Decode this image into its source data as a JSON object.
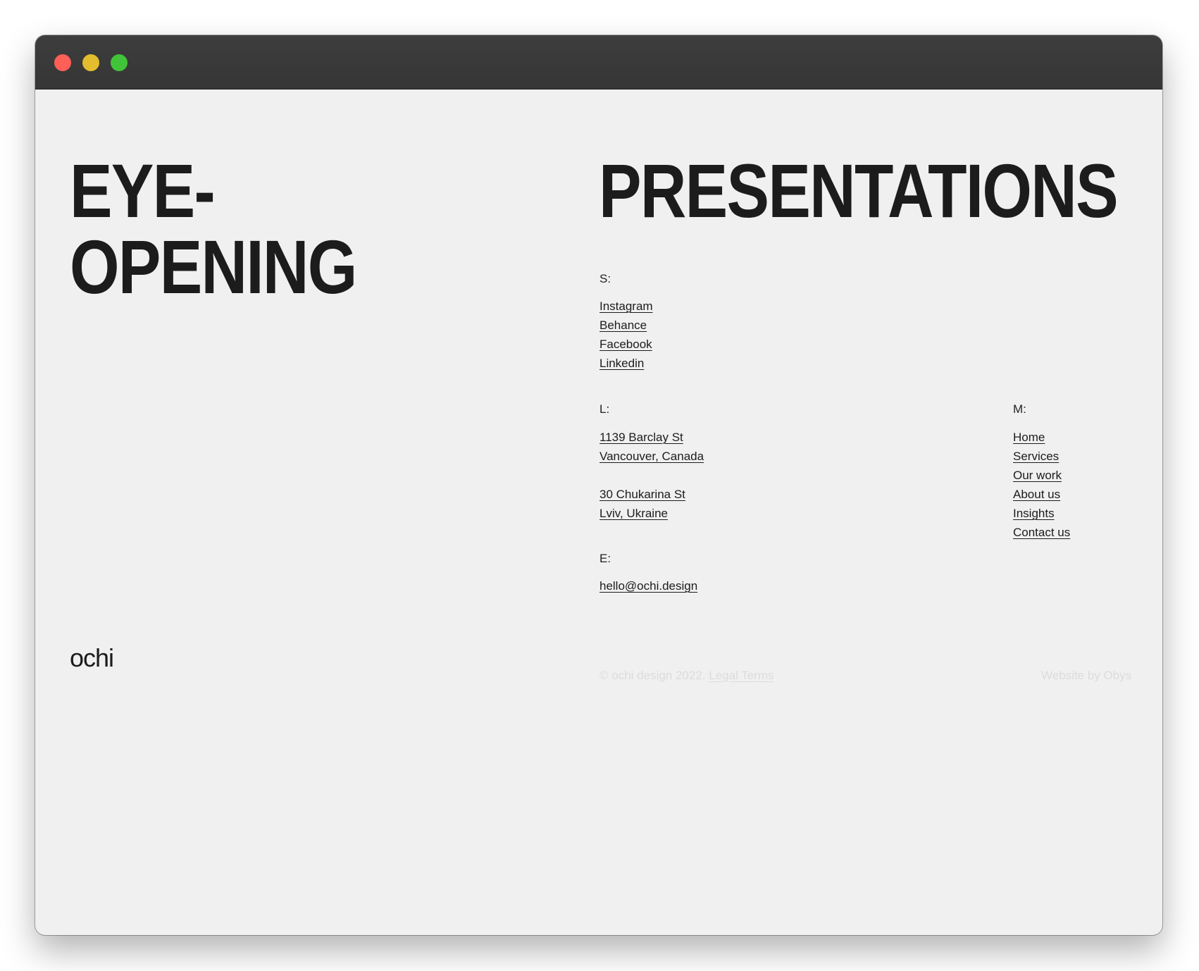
{
  "window": {
    "controls": [
      "close",
      "minimize",
      "maximize"
    ],
    "control_colors": {
      "close": "#fe5f57",
      "minimize": "#e3bd2e",
      "maximize": "#42c43a"
    }
  },
  "headline": {
    "line1": "EYE-",
    "line2": "OPENING",
    "line3": "PRESENTATIONS"
  },
  "socials": {
    "label": "S:",
    "items": [
      "Instagram",
      "Behance",
      "Facebook",
      "Linkedin"
    ]
  },
  "locations": {
    "label": "L:",
    "address1_line1": "1139 Barclay St",
    "address1_line2": "Vancouver, Canada",
    "address2_line1": "30 Chukarina St",
    "address2_line2": "Lviv, Ukraine"
  },
  "email": {
    "label": "E:",
    "value": "hello@ochi.design"
  },
  "menu": {
    "label": "M:",
    "items": [
      "Home",
      "Services",
      "Our work",
      "About us",
      "Insights",
      "Contact us"
    ]
  },
  "footer": {
    "logo": "ochi",
    "copyright": "© ochi design 2022.",
    "legal": "Legal Terms",
    "credit": "Website by Obys"
  },
  "colors": {
    "background": "#f0f0f0",
    "text": "#1c1c1c",
    "footer_text": "#dcdcdc",
    "titlebar": "#3a3a3a"
  }
}
